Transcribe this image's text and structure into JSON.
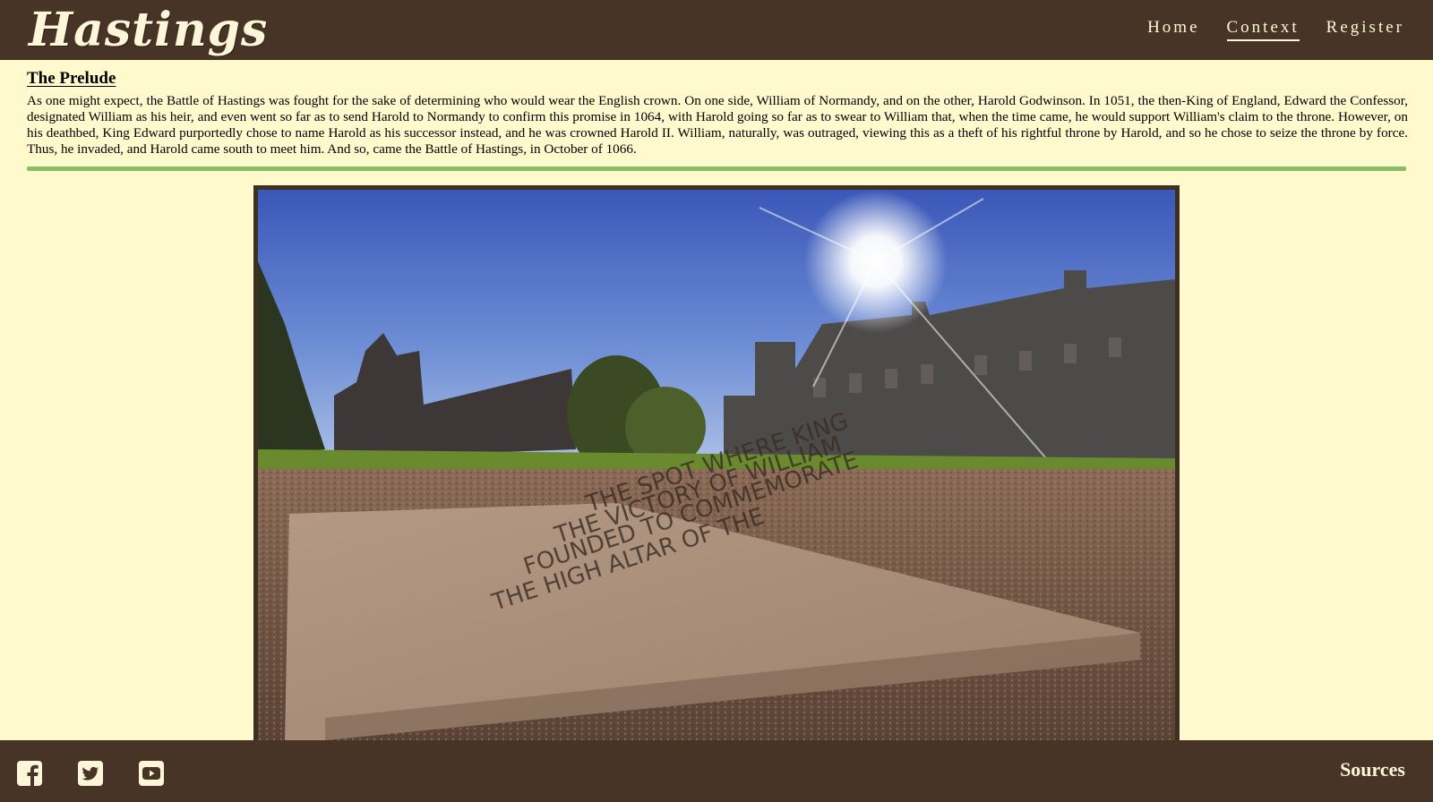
{
  "header": {
    "logo_text": "Hastings",
    "nav": [
      {
        "label": "Home"
      },
      {
        "label": "Context"
      },
      {
        "label": "Register"
      }
    ]
  },
  "section": {
    "title": "The Prelude",
    "body": "As one might expect, the Battle of Hastings was fought for the sake of determining who would wear the English crown. On one side, William of Normandy, and on the other, Harold Godwinson. In 1051, the then-King of England, Edward the Confessor, designated William as his heir, and even went so far as to send Harold to Normandy to confirm this promise in 1064, with Harold going so far as to swear to William that, when the time came, he would support William's claim to the throne. However, on his deathbed, King Edward purportedly chose to name Harold as his successor instead, and he was crowned Harold II. William, naturally, was outraged, viewing this as a theft of his rightful throne by Harold, and so he chose to seize the throne by force. Thus, he invaded, and Harold came south to meet him. And so, came the Battle of Hastings, in October of 1066."
  },
  "photo": {
    "stone_lines": [
      "THE HIGH ALTAR OF THE",
      "FOUNDED TO COMMEMORATE",
      "THE VICTORY OF WILLIAM",
      "THE SPOT WHERE KING"
    ]
  },
  "footer": {
    "social": [
      {
        "icon": "facebook-icon"
      },
      {
        "icon": "twitter-icon"
      },
      {
        "icon": "youtube-icon"
      }
    ],
    "sources_label": "Sources"
  },
  "colors": {
    "header_bg": "#473426",
    "page_bg": "#fffacd",
    "divider": "#8abd64",
    "header_text": "#fdf6d8"
  }
}
